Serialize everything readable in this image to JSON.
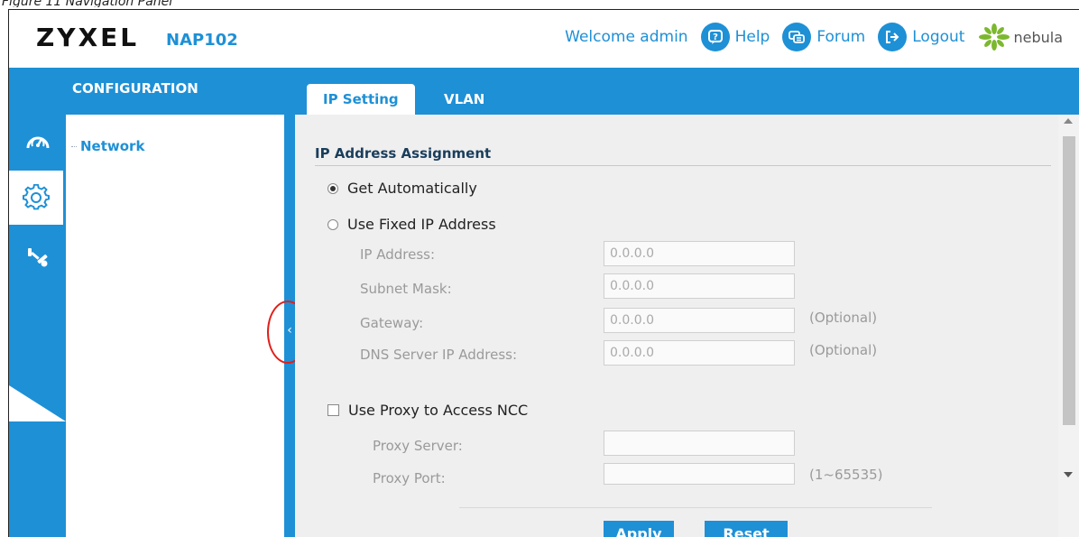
{
  "caption": "Figure 11 Navigation Panel",
  "header": {
    "brand": "ZYXEL",
    "model": "NAP102",
    "welcome": "Welcome admin",
    "help": "Help",
    "forum": "Forum",
    "logout": "Logout",
    "nebula": "nebula"
  },
  "topbar": {
    "config_title": "CONFIGURATION",
    "tabs": [
      {
        "label": "IP Setting",
        "active": true
      },
      {
        "label": "VLAN",
        "active": false
      }
    ]
  },
  "rail": {
    "items": [
      {
        "icon": "dashboard-gauge-icon",
        "active": false
      },
      {
        "icon": "gear-icon",
        "active": true
      },
      {
        "icon": "maintenance-tools-icon",
        "active": false
      }
    ]
  },
  "nav": {
    "items": [
      {
        "label": "Network"
      }
    ]
  },
  "collapse_handle": {
    "icon": "chevron-left-icon"
  },
  "form": {
    "section_title": "IP Address Assignment",
    "get_auto_label": "Get Automatically",
    "get_auto_checked": true,
    "fixed_ip_label": "Use Fixed IP Address",
    "fixed_ip_checked": false,
    "fields": [
      {
        "label": "IP Address:",
        "value": "0.0.0.0",
        "hint": ""
      },
      {
        "label": "Subnet Mask:",
        "value": "0.0.0.0",
        "hint": ""
      },
      {
        "label": "Gateway:",
        "value": "0.0.0.0",
        "hint": "(Optional)"
      },
      {
        "label": "DNS Server IP Address:",
        "value": "0.0.0.0",
        "hint": "(Optional)"
      }
    ],
    "proxy_label": "Use Proxy to Access NCC",
    "proxy_checked": false,
    "proxy_fields": [
      {
        "label": "Proxy Server:",
        "value": "",
        "hint": ""
      },
      {
        "label": "Proxy Port:",
        "value": "",
        "hint": "(1~65535)"
      }
    ],
    "apply_label": "Apply",
    "reset_label": "Reset"
  },
  "colors": {
    "accent": "#1e90d6",
    "highlight": "#e0201a",
    "content_bg": "#efefef"
  }
}
